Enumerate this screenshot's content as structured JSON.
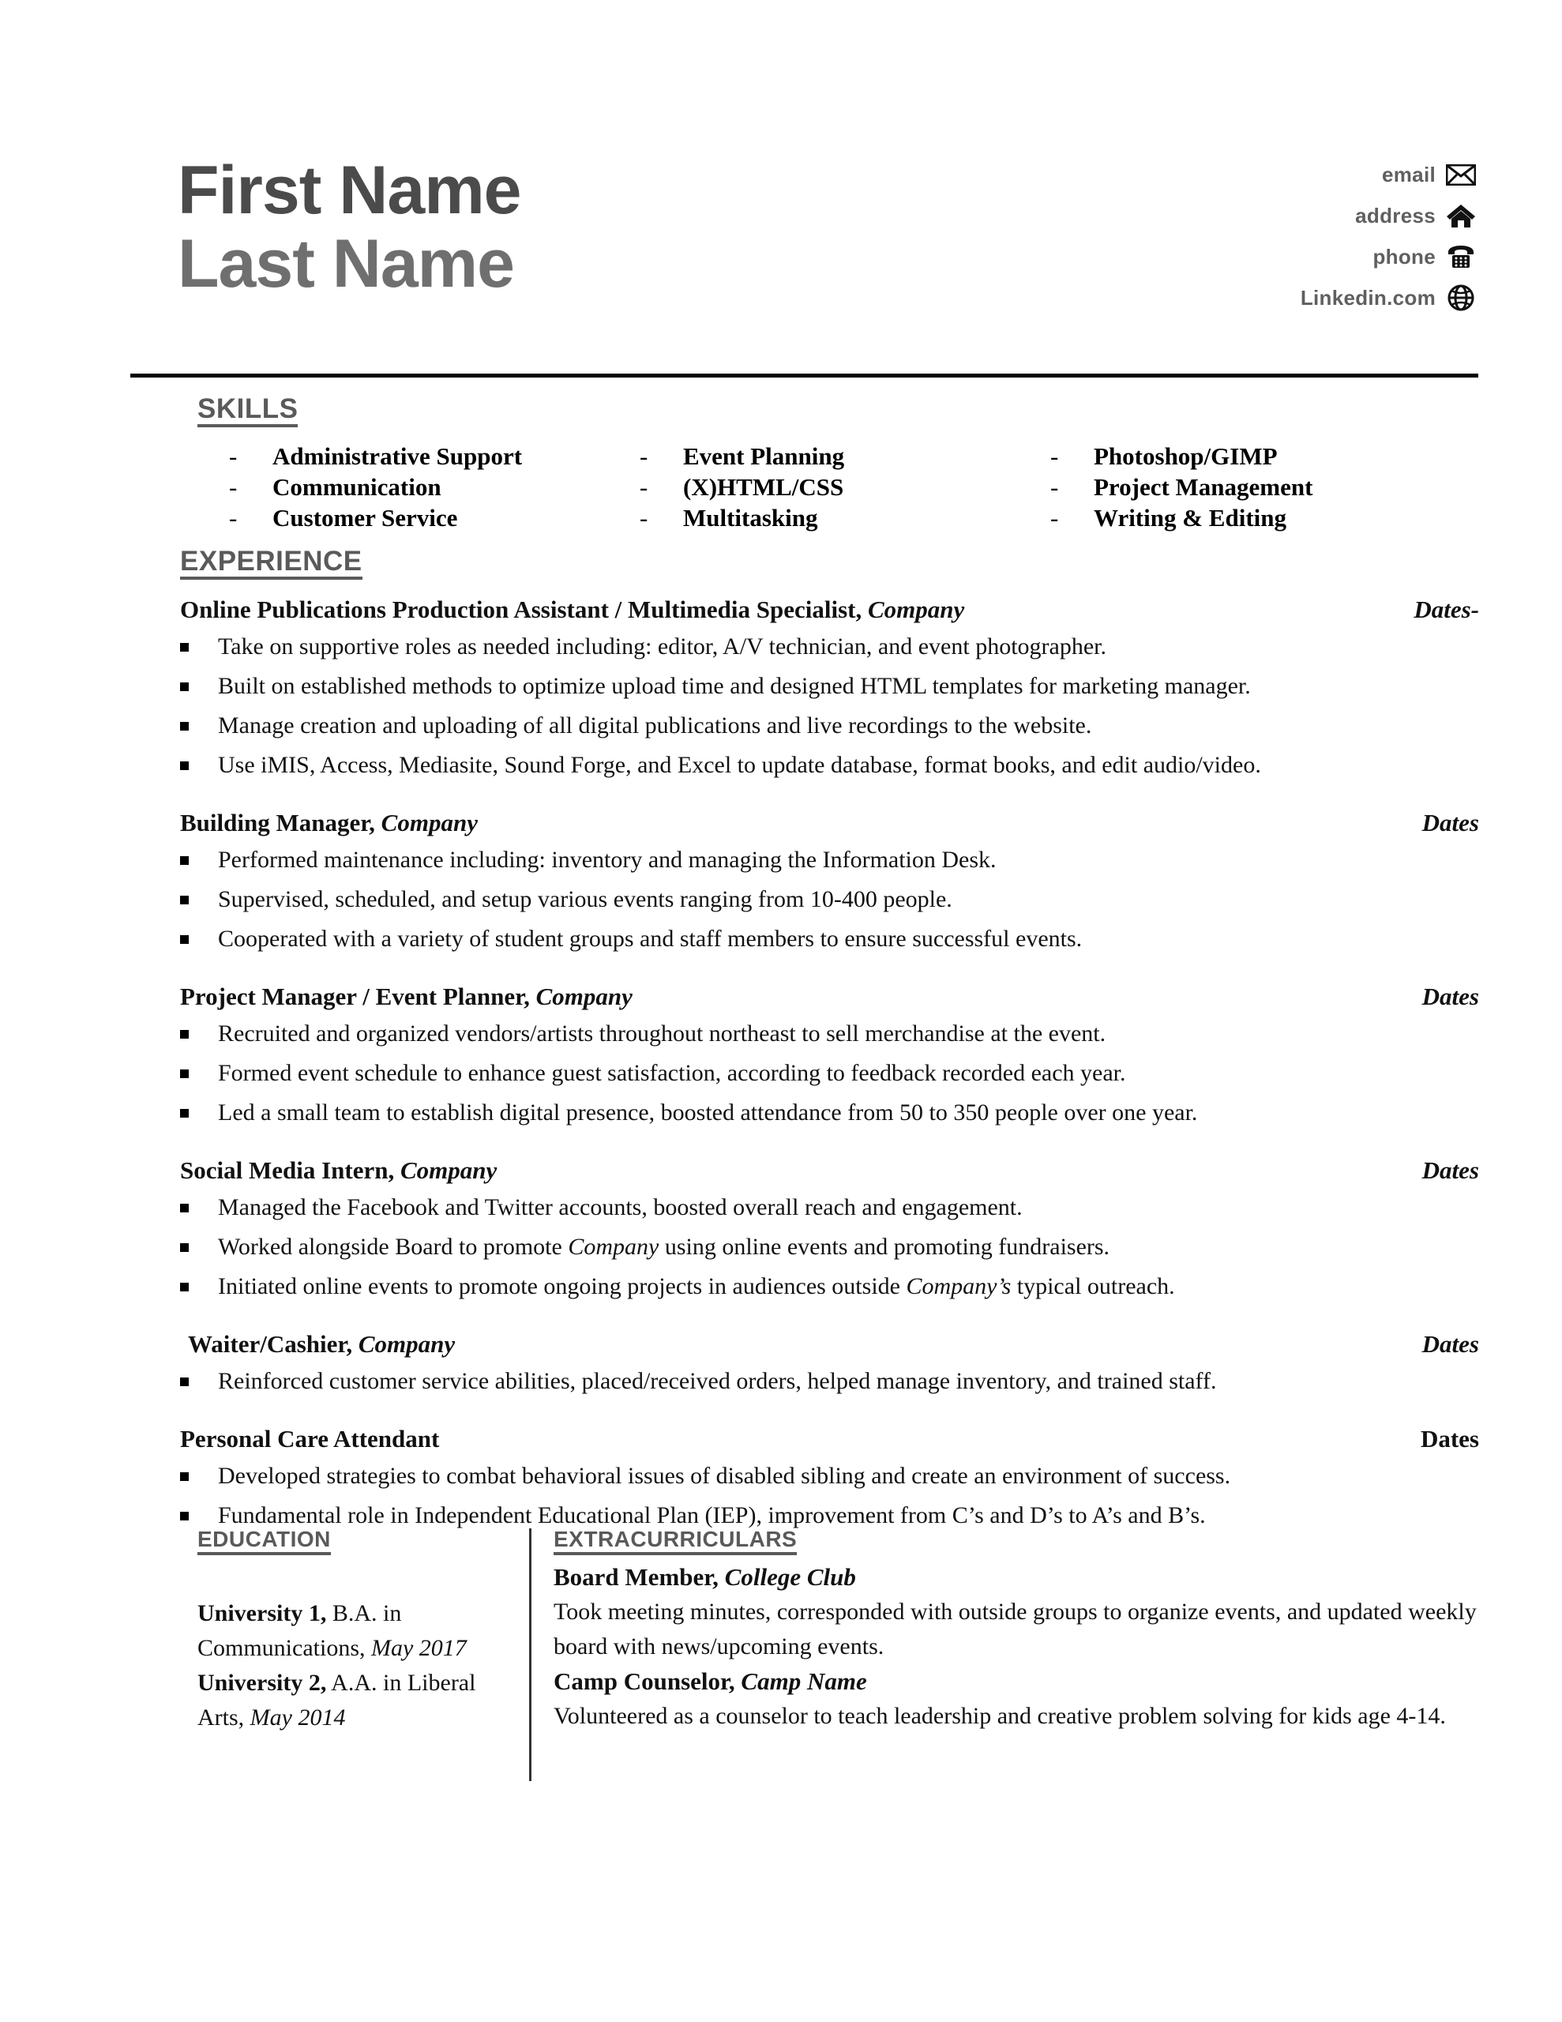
{
  "header": {
    "first_name": "First Name",
    "last_name": "Last Name",
    "contacts": [
      {
        "label": "email",
        "icon": "envelope-icon"
      },
      {
        "label": "address",
        "icon": "house-icon"
      },
      {
        "label": "phone",
        "icon": "telephone-icon"
      },
      {
        "label": "Linkedin.com",
        "icon": "globe-icon"
      }
    ]
  },
  "skills": {
    "heading": "SKILLS",
    "dash": "-",
    "items": [
      "Administrative Support",
      "Event Planning",
      "Photoshop/GIMP",
      "Communication",
      "(X)HTML/CSS",
      "Project Management",
      "Customer Service",
      "Multitasking",
      "Writing & Editing"
    ]
  },
  "experience": {
    "heading": "EXPERIENCE",
    "jobs": [
      {
        "title": "Online Publications Production Assistant / Multimedia Specialist, ",
        "company": "Company",
        "dates": "Dates-",
        "dates_italic": true,
        "indent": false,
        "bullets": [
          "Take on supportive roles as needed including: editor, A/V technician, and event photographer.",
          "Built on established methods to optimize upload time and designed HTML templates for marketing manager.",
          "Manage creation and uploading of all digital publications and live recordings to the website.",
          "Use iMIS, Access, Mediasite, Sound Forge, and Excel to update database, format books, and edit audio/video."
        ]
      },
      {
        "title": "Building Manager, ",
        "company": "Company",
        "dates": "Dates",
        "dates_italic": true,
        "indent": false,
        "bullets": [
          "Performed maintenance including: inventory and managing the Information Desk.",
          "Supervised, scheduled, and setup various events ranging from 10-400 people.",
          "Cooperated with a variety of student groups and staff members to ensure successful events."
        ]
      },
      {
        "title": "Project Manager / Event Planner, ",
        "company": "Company",
        "dates": "Dates",
        "dates_italic": true,
        "indent": false,
        "bullets": [
          "Recruited and organized vendors/artists throughout northeast to sell merchandise at the event.",
          "Formed event schedule to enhance guest satisfaction, according to feedback recorded each year.",
          "Led a small team to establish digital presence, boosted attendance from 50 to 350 people over one year."
        ]
      },
      {
        "title": "Social Media Intern, ",
        "company": "Company",
        "dates": "Dates",
        "dates_italic": true,
        "indent": false,
        "bullets_rich": [
          [
            {
              "t": "Managed the Facebook and Twitter accounts, boosted overall reach and engagement.",
              "i": false
            }
          ],
          [
            {
              "t": "Worked alongside Board to promote ",
              "i": false
            },
            {
              "t": "Company",
              "i": true
            },
            {
              "t": " using online events and promoting fundraisers.",
              "i": false
            }
          ],
          [
            {
              "t": "Initiated online events to promote ongoing projects in audiences outside ",
              "i": false
            },
            {
              "t": "Company’s",
              "i": true
            },
            {
              "t": " typical outreach.",
              "i": false
            }
          ]
        ]
      },
      {
        "title": "Waiter/Cashier, ",
        "company": "Company",
        "dates": "Dates",
        "dates_italic": true,
        "indent": true,
        "bullets": [
          "Reinforced customer service abilities, placed/received orders, helped manage inventory, and trained staff."
        ]
      },
      {
        "title": "Personal Care Attendant",
        "company": "",
        "dates": "Dates",
        "dates_italic": false,
        "indent": false,
        "bullets": [
          "Developed strategies to combat behavioral issues of disabled sibling and create an environment of success.",
          "Fundamental role in Independent Educational Plan (IEP), improvement from C’s and D’s to A’s and B’s."
        ]
      }
    ]
  },
  "education": {
    "heading": "EDUCATION",
    "entries": [
      {
        "school": "University 1,",
        "degree": " B.A. in Communications, ",
        "date": "May 2017"
      },
      {
        "school": "University 2,",
        "degree": " A.A. in Liberal Arts, ",
        "date": "May 2014"
      }
    ]
  },
  "extracurriculars": {
    "heading": "EXTRACURRICULARS",
    "entries": [
      {
        "role": "Board Member, ",
        "org": "College Club",
        "desc": "Took meeting minutes, corresponded with outside groups to organize events, and updated weekly board with news/upcoming events."
      },
      {
        "role": "Camp Counselor, ",
        "org": "Camp Name",
        "desc": "Volunteered as a counselor to teach leadership and creative problem solving for kids age 4-14."
      }
    ]
  }
}
